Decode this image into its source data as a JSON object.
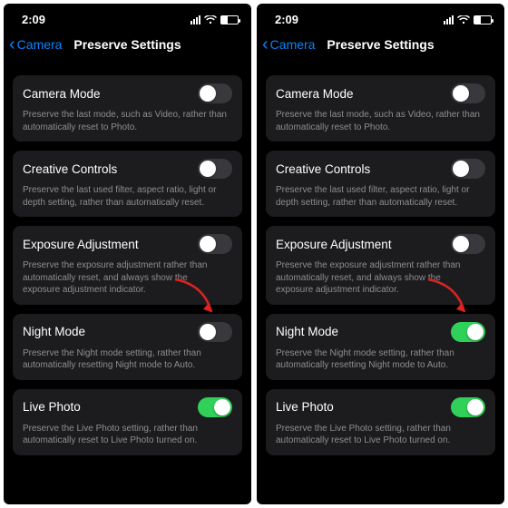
{
  "panes": [
    {
      "time": "2:09",
      "back_label": "Camera",
      "title": "Preserve Settings",
      "settings": [
        {
          "label": "Camera Mode",
          "on": false,
          "desc": "Preserve the last mode, such as Video, rather than automatically reset to Photo."
        },
        {
          "label": "Creative Controls",
          "on": false,
          "desc": "Preserve the last used filter, aspect ratio, light or depth setting, rather than automatically reset."
        },
        {
          "label": "Exposure Adjustment",
          "on": false,
          "desc": "Preserve the exposure adjustment rather than automatically reset, and always show the exposure adjustment indicator."
        },
        {
          "label": "Night Mode",
          "on": false,
          "desc": "Preserve the Night mode setting, rather than automatically resetting Night mode to Auto."
        },
        {
          "label": "Live Photo",
          "on": true,
          "desc": "Preserve the Live Photo setting, rather than automatically reset to Live Photo turned on."
        }
      ],
      "arrow_target_index": 3
    },
    {
      "time": "2:09",
      "back_label": "Camera",
      "title": "Preserve Settings",
      "settings": [
        {
          "label": "Camera Mode",
          "on": false,
          "desc": "Preserve the last mode, such as Video, rather than automatically reset to Photo."
        },
        {
          "label": "Creative Controls",
          "on": false,
          "desc": "Preserve the last used filter, aspect ratio, light or depth setting, rather than automatically reset."
        },
        {
          "label": "Exposure Adjustment",
          "on": false,
          "desc": "Preserve the exposure adjustment rather than automatically reset, and always show the exposure adjustment indicator."
        },
        {
          "label": "Night Mode",
          "on": true,
          "desc": "Preserve the Night mode setting, rather than automatically resetting Night mode to Auto."
        },
        {
          "label": "Live Photo",
          "on": true,
          "desc": "Preserve the Live Photo setting, rather than automatically reset to Live Photo turned on."
        }
      ],
      "arrow_target_index": 3
    }
  ]
}
